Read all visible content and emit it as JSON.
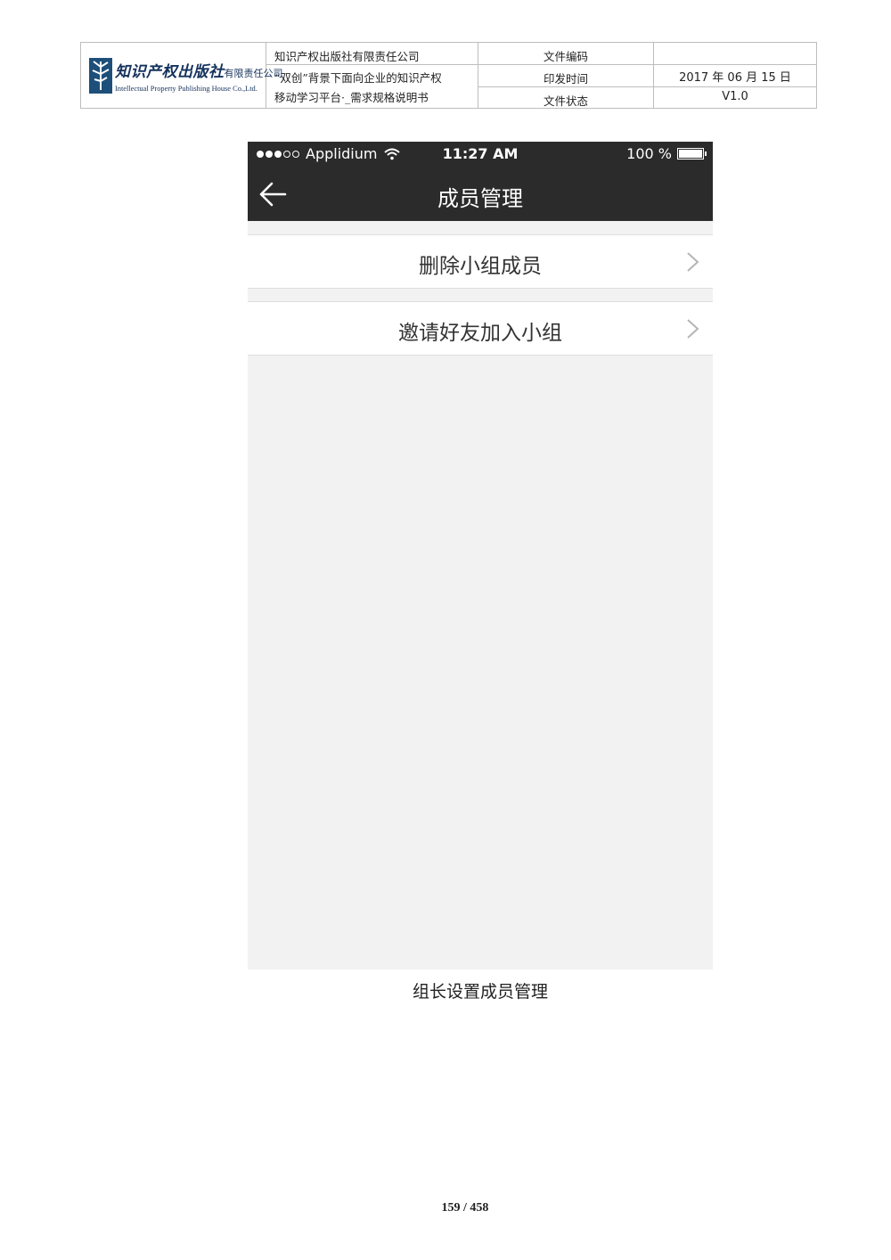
{
  "header": {
    "logo": {
      "name_cn": "知识产权出版社",
      "name_suffix": "有限责任公司",
      "name_en": "Intellectual Property Publishing House Co.,Ltd."
    },
    "publisher": "知识产权出版社有限责任公司",
    "doc_title_line1": "“双创”背景下面向企业的知识产权",
    "doc_title_line2": "移动学习平台·_需求规格说明书",
    "meta": [
      {
        "label": "文件编码",
        "value": ""
      },
      {
        "label": "印发时间",
        "value": "2017 年 06 月 15 日"
      },
      {
        "label": "文件状态",
        "value": "V1.0"
      }
    ]
  },
  "phone": {
    "status_bar": {
      "carrier": "Applidium",
      "time": "11:27 AM",
      "battery": "100 %",
      "battery_level": 1.0
    },
    "nav": {
      "title": "成员管理"
    },
    "menu": [
      {
        "label": "删除小组成员"
      },
      {
        "label": "邀请好友加入小组"
      }
    ]
  },
  "caption": "组长设置成员管理",
  "page_number": "159 / 458",
  "icons": [
    "logo-mark-icon",
    "signal-icon",
    "wifi-icon",
    "battery-icon",
    "back-arrow-icon",
    "chevron-right-icon"
  ],
  "colors": {
    "nav_bg": "#2b2b2b",
    "screen_bg": "#f2f2f2",
    "logo_blue": "#14325c"
  }
}
